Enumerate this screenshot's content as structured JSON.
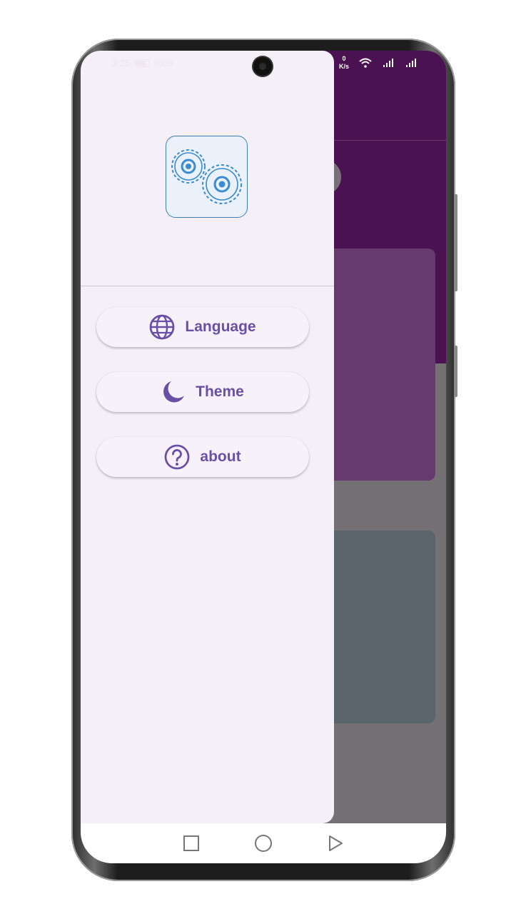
{
  "status_bar": {
    "time": "3:25",
    "battery": "%89",
    "net_speed_top": "0",
    "net_speed_unit": "K/s"
  },
  "drawer": {
    "logo_icon": "gears-icon",
    "menu": [
      {
        "label": "Language",
        "icon": "globe-icon"
      },
      {
        "label": "Theme",
        "icon": "moon-icon"
      },
      {
        "label": "about",
        "icon": "help-circle-icon"
      }
    ]
  },
  "navbar": {
    "buttons": [
      "recents-square-icon",
      "home-circle-icon",
      "back-triangle-icon"
    ]
  },
  "colors": {
    "accent": "#6a4fa6",
    "app_header": "#4a1250",
    "drawer_bg": "#f5f0f8"
  }
}
